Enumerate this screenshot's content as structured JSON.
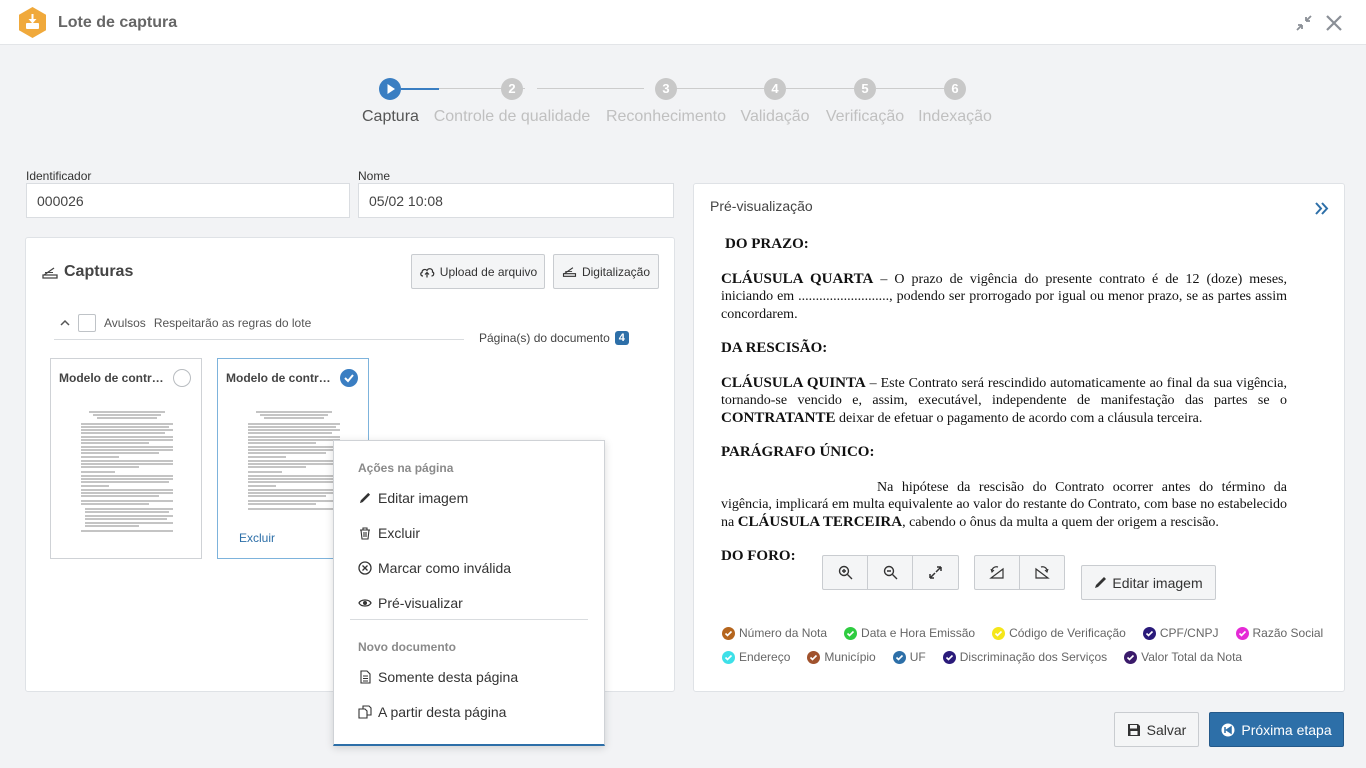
{
  "window": {
    "title": "Lote de captura"
  },
  "stepper": {
    "steps": [
      {
        "num": "",
        "label": "Captura"
      },
      {
        "num": "2",
        "label": "Controle de qualidade"
      },
      {
        "num": "3",
        "label": "Reconhecimento"
      },
      {
        "num": "4",
        "label": "Validação"
      },
      {
        "num": "5",
        "label": "Verificação"
      },
      {
        "num": "6",
        "label": "Indexação"
      }
    ]
  },
  "fields": {
    "identificador_label": "Identificador",
    "identificador_value": "000026",
    "nome_label": "Nome",
    "nome_value": "05/02 10:08"
  },
  "capturas": {
    "title": "Capturas",
    "upload_label": "Upload de arquivo",
    "scan_label": "Digitalização",
    "avulsos_label": "Avulsos",
    "avulsos_note": "Respeitarão as regras do lote",
    "pages_label": "Página(s) do documento",
    "pages_count": "4",
    "cards": [
      {
        "title": "Modelo de contrato",
        "selected": false
      },
      {
        "title": "Modelo de contrato",
        "selected": true,
        "action": "Excluir"
      }
    ]
  },
  "context_menu": {
    "header_page": "Ações na página",
    "items_page": [
      "Editar imagem",
      "Excluir",
      "Marcar como inválida",
      "Pré-visualizar"
    ],
    "header_doc": "Novo documento",
    "items_doc": [
      "Somente desta página",
      "A partir desta página"
    ]
  },
  "preview": {
    "title": "Pré-visualização",
    "edit_label": "Editar imagem",
    "doc": {
      "h1": "DO PRAZO:",
      "p1_bold": "CLÁUSULA QUARTA",
      "p1": " – O prazo de vigência do presente contrato é de 12 (doze) meses, iniciando em .........................., podendo ser prorrogado por igual ou menor prazo, se as partes assim concordarem.",
      "h2": "DA RESCISÃO:",
      "p2_bold": "CLÁUSULA QUINTA",
      "p2a": " – Este Contrato será rescindido automaticamente ao final da sua vigência, tornando-se vencido e, assim, executável, independente de manifestação das partes se o ",
      "p2_bold2": "CONTRATANTE",
      "p2b": " deixar de efetuar o pagamento de acordo com a cláusula terceira.",
      "h3": "PARÁGRAFO ÚNICO:",
      "p3a": "Na hipótese da rescisão do Contrato ocorrer antes do término da vigência, implicará em multa equivalente ao valor do restante do Contrato, com base no estabelecido na ",
      "p3_bold": "CLÁUSULA TERCEIRA",
      "p3b": ", cabendo o ônus da multa a quem der origem a rescisão.",
      "h4": "DO FORO:"
    },
    "legend": [
      {
        "label": "Número da Nota",
        "color": "#b5651d"
      },
      {
        "label": "Data e Hora Emissão",
        "color": "#2ecc40"
      },
      {
        "label": "Código de Verificação",
        "color": "#f5e61a"
      },
      {
        "label": "CPF/CNPJ",
        "color": "#2a1a7a"
      },
      {
        "label": "Razão Social",
        "color": "#e52ad6"
      },
      {
        "label": "Endereço",
        "color": "#3ee0e8"
      },
      {
        "label": "Município",
        "color": "#a0522d"
      },
      {
        "label": "UF",
        "color": "#2d6fa8"
      },
      {
        "label": "Discriminação dos Serviços",
        "color": "#2a1a7a"
      },
      {
        "label": "Valor Total da Nota",
        "color": "#3a1a6a"
      }
    ]
  },
  "footer": {
    "save_label": "Salvar",
    "next_label": "Próxima etapa"
  }
}
